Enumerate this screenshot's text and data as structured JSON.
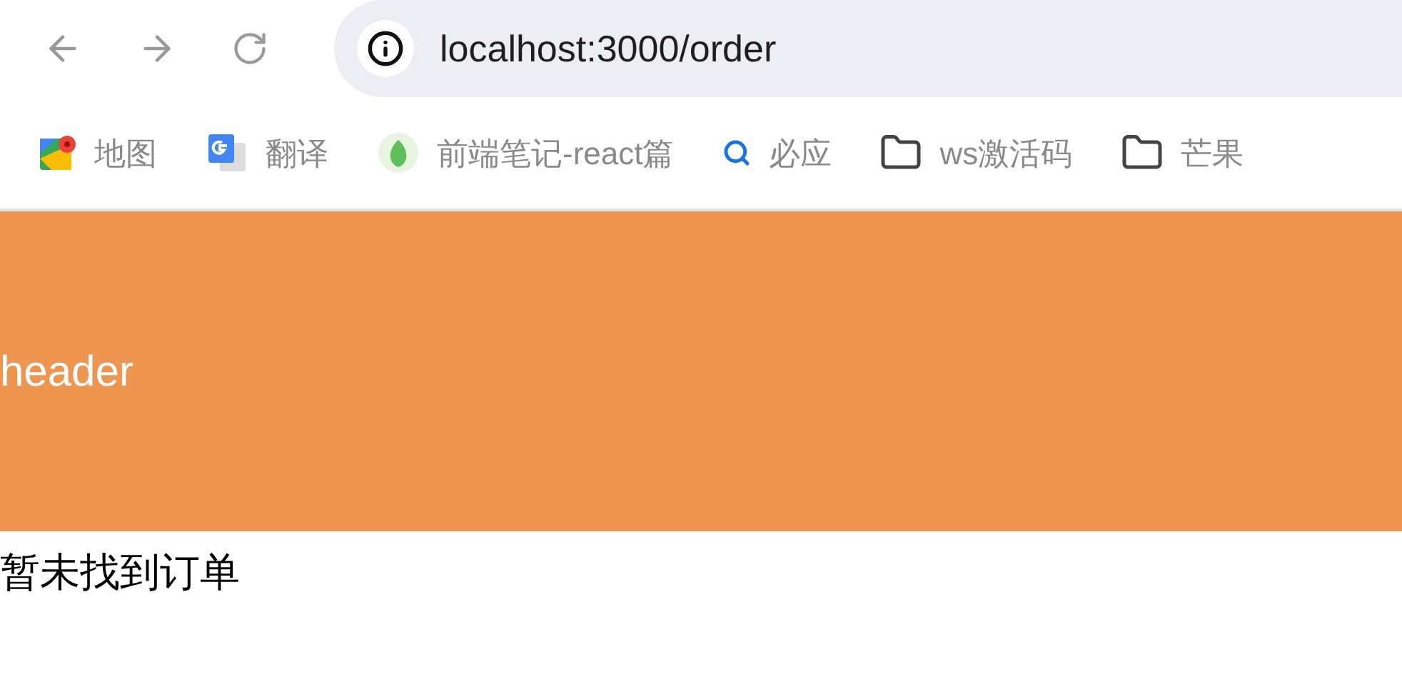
{
  "browser": {
    "url": "localhost:3000/order"
  },
  "bookmarks": [
    {
      "kind": "maps",
      "label": "地图"
    },
    {
      "kind": "translate",
      "label": "翻译"
    },
    {
      "kind": "site",
      "label": "前端笔记-react篇"
    },
    {
      "kind": "search",
      "label": "必应"
    },
    {
      "kind": "folder",
      "label": "ws激活码"
    },
    {
      "kind": "folder",
      "label": "芒果"
    }
  ],
  "page": {
    "header": "header",
    "message": "暂未找到订单"
  }
}
